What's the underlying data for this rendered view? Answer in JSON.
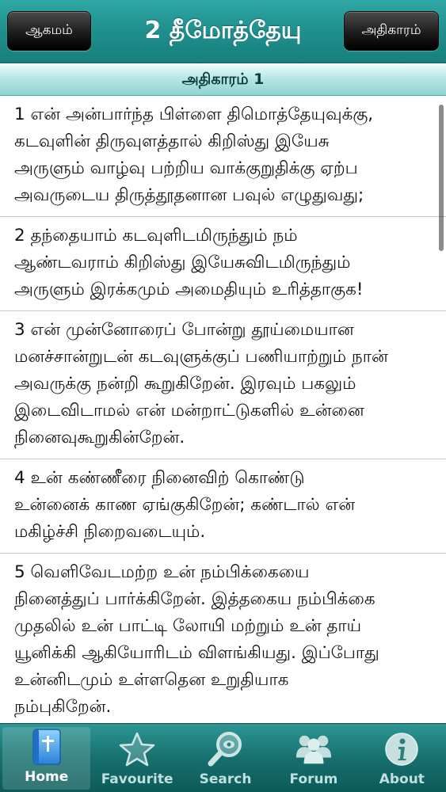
{
  "navbar": {
    "title": "2 தீமோத்தேயு",
    "left_button": "ஆகமம்",
    "right_button": "அதிகாரம்"
  },
  "chapter_header": "அதிகாரம் 1",
  "verses": [
    "1 என் அன்பார்ந்த பிள்ளை திமொத்தேயுவுக்கு,\nகடவுளின் திருவுளத்தால் கிறிஸ்து இயேசு\nஅருளும் வாழ்வு பற்றிய வாக்குறுதிக்கு ஏற்ப\nஅவருடைய திருத்தூதனான பவுல் எழுதுவது;",
    "2 தந்தையாம் கடவுளிடமிருந்தும் நம்\nஆண்டவராம் கிறிஸ்து இயேசுவிடமிருந்தும்\nஅருளும் இரக்கமும் அமைதியும் உரித்தாகுக!",
    "3 என் முன்னோரைப் போன்று தூய்மையான\nமனச்சான்றுடன் கடவுளுக்குப் பணியாற்றும் நான்\nஅவருக்கு நன்றி கூறுகிறேன். இரவும் பகலும்\nஇடைவிடாமல் என் மன்றாட்டுகளில் உன்னை\nநினைவுகூறுகின்றேன்.",
    "4 உன் கண்ணீரை நினைவிற் கொண்டு\nஉன்னைக் காண ஏங்குகிறேன்; கண்டால் என்\nமகிழ்ச்சி நிறைவடையும்.",
    "5 வெளிவேடமற்ற உன் நம்பிக்கையை\nநினைத்துப் பார்க்கிறேன். இத்தகைய நம்பிக்கை\nமுதலில் உன் பாட்டி லோயி மற்றும் உன் தாய்\nயூனிக்கி ஆகியோரிடம் விளங்கியது. இப்போது\nஉன்னிடமும் உள்ளதென உறுதியாக\nநம்புகிறேன்."
  ],
  "tabs": [
    {
      "label": "Home",
      "icon": "bible-icon",
      "active": true
    },
    {
      "label": "Favourite",
      "icon": "star-icon",
      "active": false
    },
    {
      "label": "Search",
      "icon": "magnifier-icon",
      "active": false
    },
    {
      "label": "Forum",
      "icon": "people-icon",
      "active": false
    },
    {
      "label": "About",
      "icon": "info-icon",
      "active": false
    }
  ],
  "colors": {
    "navbar": "#1f8f8d",
    "chapter_header": "#b6e6e4",
    "tabbar": "#17706e"
  }
}
